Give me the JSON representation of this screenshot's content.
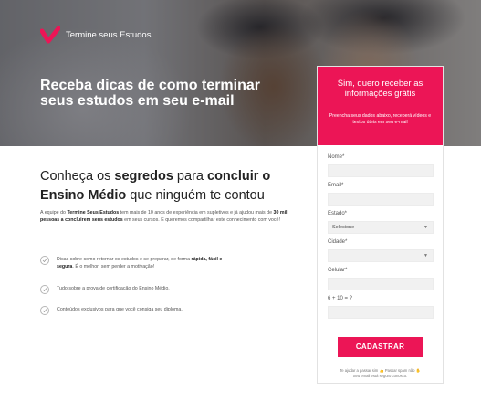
{
  "brand": {
    "name": "Termine seus Estudos",
    "color": "#ec1556"
  },
  "hero": {
    "title": "Receba dicas de como terminar seus estudos em seu e-mail"
  },
  "form": {
    "title": "Sim, quero receber as informações grátis",
    "subtitle": "Preencha seus dados abaixo, receberá vídeos e textos úteis em seu e-mail",
    "fields": [
      {
        "label": "Nome*",
        "value": ""
      },
      {
        "label": "Email*",
        "value": ""
      },
      {
        "label": "Estado*",
        "value": "Selecione",
        "type": "select"
      },
      {
        "label": "Cidade*",
        "value": "",
        "type": "select"
      },
      {
        "label": "Celular*",
        "value": ""
      },
      {
        "label": "6 + 10 = ?",
        "value": ""
      }
    ],
    "submit_label": "CADASTRAR",
    "privacy_line1": "Te ajudar a passar sim 👍 Passar spam não ✋",
    "privacy_line2": "Seu email está seguro conosco."
  },
  "main": {
    "heading_parts": [
      "Conheça os ",
      "segredos",
      " para ",
      "concluir o Ensino Médio",
      " que ninguém te contou"
    ],
    "intro_parts": [
      "A equipe do ",
      "Termine Seus Estudos",
      " tem mais de 10 anos de experiência em supletivos e já ajudou mais de ",
      "30 mil pessoas a concluirem seus estudos",
      " em seus cursos. E queremos compartilhar este conhecimento com você!"
    ],
    "benefits": [
      {
        "parts": [
          "Dicas sobre como retornar os estudos e se preparar, de forma ",
          "rápida, fácil e segura",
          ". É o melhor: sem perder a motivação!"
        ]
      },
      {
        "parts": [
          "Tudo sobre a prova de certificação do Ensino Médio."
        ]
      },
      {
        "parts": [
          "Conteúdos exclusivos para que você consiga seu diploma."
        ]
      }
    ]
  }
}
